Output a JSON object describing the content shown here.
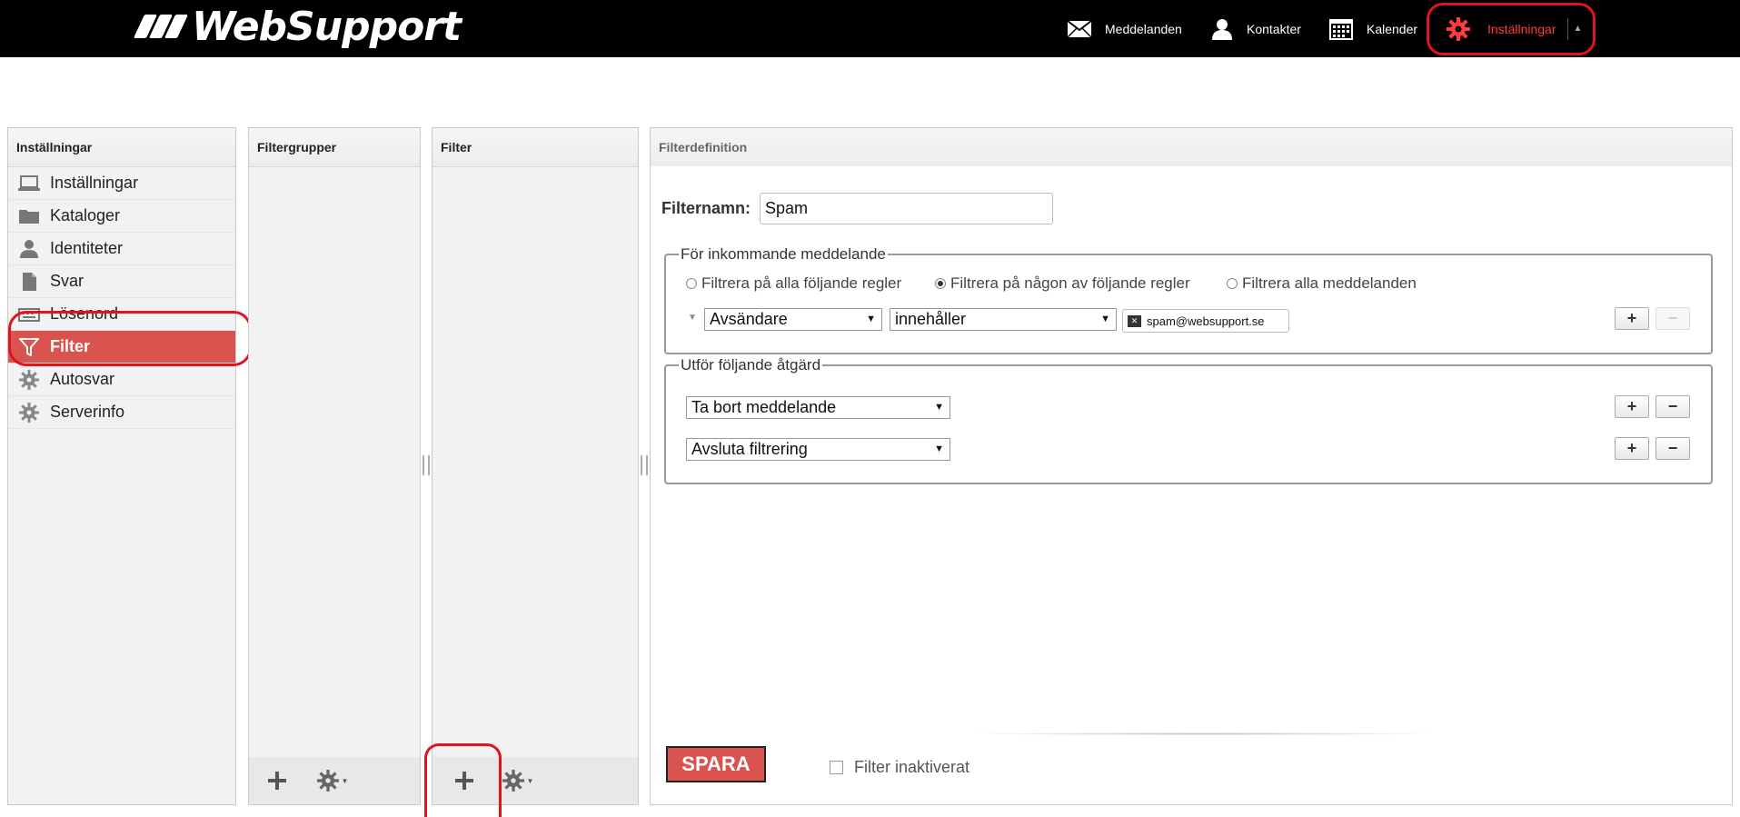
{
  "app": {
    "brand": "WebSupport"
  },
  "topnav": {
    "messages": "Meddelanden",
    "contacts": "Kontakter",
    "calendar": "Kalender",
    "settings": "Inställningar"
  },
  "settings_panel": {
    "title": "Inställningar",
    "items": [
      {
        "label": "Inställningar",
        "icon": "laptop-icon"
      },
      {
        "label": "Kataloger",
        "icon": "folder-icon"
      },
      {
        "label": "Identiteter",
        "icon": "user-icon"
      },
      {
        "label": "Svar",
        "icon": "document-icon"
      },
      {
        "label": "Lösenord",
        "icon": "keyboard-icon"
      },
      {
        "label": "Filter",
        "icon": "funnel-icon",
        "active": true
      },
      {
        "label": "Autosvar",
        "icon": "gear-icon"
      },
      {
        "label": "Serverinfo",
        "icon": "gear-icon"
      }
    ]
  },
  "filtergroups_panel": {
    "title": "Filtergrupper"
  },
  "filter_panel": {
    "title": "Filter"
  },
  "definition": {
    "title": "Filterdefinition",
    "name_label": "Filternamn:",
    "name_value": "Spam",
    "incoming": {
      "legend": "För inkommande meddelande",
      "radio_all_rules": "Filtrera på alla följande regler",
      "radio_any_rule": "Filtrera på någon av följande regler",
      "radio_all_messages": "Filtrera alla meddelanden",
      "selected": "any",
      "rule_field": "Avsändare",
      "rule_operator": "innehåller",
      "rule_value": "spam@websupport.se"
    },
    "actions": {
      "legend": "Utför följande åtgärd",
      "action1": "Ta bort meddelande",
      "action2": "Avsluta filtrering"
    },
    "save_label": "SPARA",
    "inactive_label": "Filter inaktiverat"
  },
  "colors": {
    "accent": "#d9534f",
    "highlight": "#e0141e",
    "topbar": "#000000",
    "nav_active": "#ff3b3b"
  }
}
